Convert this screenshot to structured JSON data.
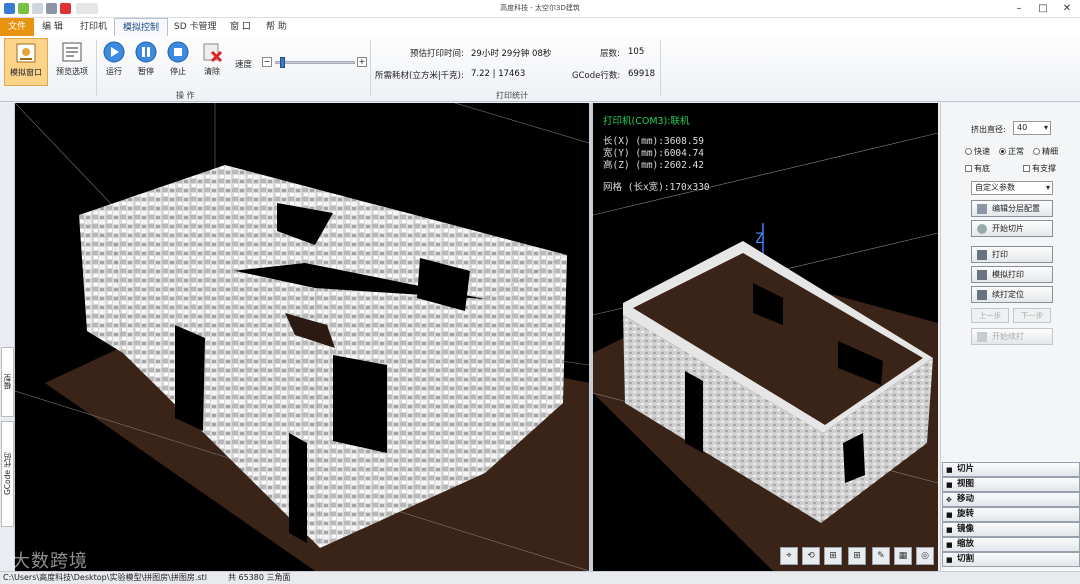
{
  "window": {
    "title": "高度科技 - 太空尔3D建筑"
  },
  "menu": {
    "tabs": [
      "文件",
      "编 辑",
      "打印机",
      "模拟控制",
      "SD 卡管理",
      "窗 口",
      "帮 助"
    ]
  },
  "ribbon": {
    "buttons": {
      "simulate_window": "模拟窗口",
      "preview_options": "预览选项",
      "run": "运行",
      "pause": "暂停",
      "stop": "停止",
      "clear": "清除"
    },
    "speed_label": "速度",
    "slider_minus": "−",
    "slider_plus": "+",
    "speed_value": 0.05,
    "group_operation": "操 作",
    "group_stats": "打印统计",
    "stats": {
      "est_time_label": "预估打印时间:",
      "est_time_value": "29小时 29分钟 08秒",
      "material_label": "所需耗材(立方米|千克):",
      "material_value": "7.22 | 17463",
      "layers_label": "层数:",
      "layers_value": "105",
      "gcode_label": "GCode行数:",
      "gcode_value": "69918"
    }
  },
  "left_tabs": {
    "tab_model": "模型",
    "tab_gcode": "GCode 代码"
  },
  "right_view": {
    "printer_status": "打印机(COM3):联机",
    "length": "长(X) (mm):3608.59",
    "width": "宽(Y) (mm):6004.74",
    "height": "高(Z) (mm):2602.42",
    "grid": "网格 (长x宽):170x330",
    "axis_z": "Z"
  },
  "view_toolbar": [
    "⌖",
    "⟲",
    "⊞",
    "⊞",
    "✎",
    "▦",
    "◎"
  ],
  "right_panel": {
    "extrude_label": "挤出直径:",
    "extrude_value": "40",
    "mode_fast": "快速",
    "mode_normal": "正常",
    "mode_fine": "精细",
    "chk_shell": "有底",
    "chk_support": "有支撑",
    "custom_params": "自定义参数",
    "btn_edit_layers": "编辑分层配置",
    "btn_start_slice": "开始切片",
    "btn_print": "打印",
    "btn_sim_print": "模拟打印",
    "btn_resume_pos": "续打定位",
    "btn_prev": "上一步",
    "btn_next": "下一步",
    "btn_start_resume": "开始续打"
  },
  "accordion": [
    "切片",
    "视图",
    "移动",
    "旋转",
    "镜像",
    "缩放",
    "切割"
  ],
  "status": {
    "path": "C:\\Users\\高度科技\\Desktop\\实验模型\\拼图房\\拼图房.stl",
    "triangles": "共 65380 三角面"
  },
  "watermark": "大数跨境",
  "colors": {
    "file_tab": "#e8930f",
    "viewport_bg": "#000000",
    "floor": "#3a2418",
    "status_green": "#22d25a"
  }
}
